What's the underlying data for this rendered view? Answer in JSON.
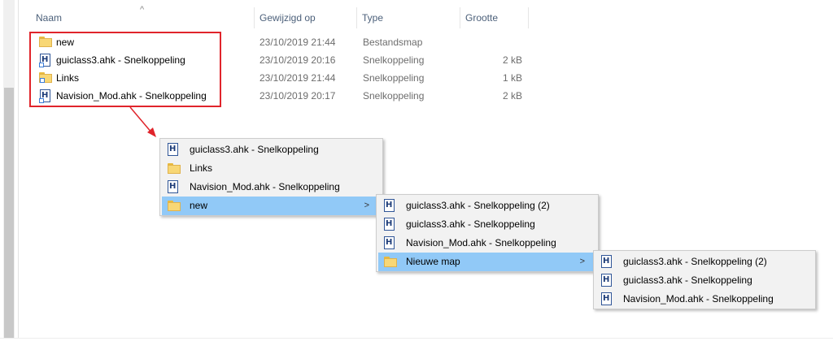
{
  "columns": {
    "name": "Naam",
    "modified": "Gewijzigd op",
    "type": "Type",
    "size": "Grootte"
  },
  "files": [
    {
      "name": "new",
      "modified": "23/10/2019 21:44",
      "type": "Bestandsmap",
      "size": "",
      "icon": "folder-icon"
    },
    {
      "name": "guiclass3.ahk - Snelkoppeling",
      "modified": "23/10/2019 20:16",
      "type": "Snelkoppeling",
      "size": "2 kB",
      "icon": "ahk-shortcut-icon"
    },
    {
      "name": "Links",
      "modified": "23/10/2019 21:44",
      "type": "Snelkoppeling",
      "size": "1 kB",
      "icon": "folder-shortcut-icon"
    },
    {
      "name": "Navision_Mod.ahk - Snelkoppeling",
      "modified": "23/10/2019 20:17",
      "type": "Snelkoppeling",
      "size": "2 kB",
      "icon": "ahk-shortcut-icon"
    }
  ],
  "menu1": [
    {
      "label": "guiclass3.ahk - Snelkoppeling",
      "icon": "ahk-icon"
    },
    {
      "label": "Links",
      "icon": "folder-icon"
    },
    {
      "label": "Navision_Mod.ahk - Snelkoppeling",
      "icon": "ahk-icon"
    },
    {
      "label": "new",
      "icon": "folder-icon",
      "submenu": ">"
    }
  ],
  "menu2": [
    {
      "label": "guiclass3.ahk - Snelkoppeling (2)",
      "icon": "ahk-icon"
    },
    {
      "label": "guiclass3.ahk - Snelkoppeling",
      "icon": "ahk-icon"
    },
    {
      "label": "Navision_Mod.ahk - Snelkoppeling",
      "icon": "ahk-icon"
    },
    {
      "label": "Nieuwe map",
      "icon": "folder-icon",
      "submenu": ">"
    }
  ],
  "menu3": [
    {
      "label": "guiclass3.ahk - Snelkoppeling (2)",
      "icon": "ahk-icon"
    },
    {
      "label": "guiclass3.ahk - Snelkoppeling",
      "icon": "ahk-icon"
    },
    {
      "label": "Navision_Mod.ahk - Snelkoppeling",
      "icon": "ahk-icon"
    }
  ],
  "colors": {
    "highlight": "#91c9f7",
    "annotation": "#e0242b",
    "header_text": "#4c607a"
  }
}
